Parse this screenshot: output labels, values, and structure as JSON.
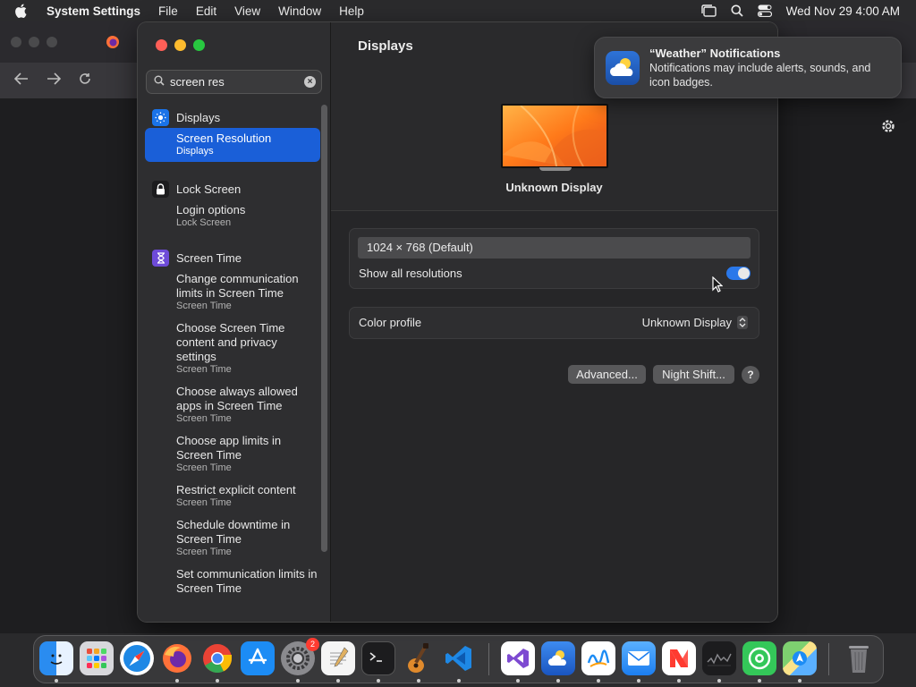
{
  "menubar": {
    "app_name": "System Settings",
    "menus": [
      "File",
      "Edit",
      "View",
      "Window",
      "Help"
    ],
    "datetime": "Wed Nov 29  4:00 AM"
  },
  "sidebar": {
    "search_value": "screen res",
    "categories": [
      {
        "label": "Displays",
        "icon": "sun-icon",
        "color": "#1a73e8",
        "items": [
          {
            "title": "Screen Resolution",
            "subtitle": "Displays",
            "selected": true
          }
        ]
      },
      {
        "label": "Lock Screen",
        "icon": "lock-icon",
        "color": "#1c1c1e",
        "items": [
          {
            "title": "Login options",
            "subtitle": "Lock Screen"
          }
        ]
      },
      {
        "label": "Screen Time",
        "icon": "hourglass-icon",
        "color": "#6e4bd8",
        "items": [
          {
            "title": "Change communication limits in Screen Time",
            "subtitle": "Screen Time"
          },
          {
            "title": "Choose Screen Time content and privacy settings",
            "subtitle": "Screen Time"
          },
          {
            "title": "Choose always allowed apps in Screen Time",
            "subtitle": "Screen Time"
          },
          {
            "title": "Choose app limits in Screen Time",
            "subtitle": "Screen Time"
          },
          {
            "title": "Restrict explicit content",
            "subtitle": "Screen Time"
          },
          {
            "title": "Schedule downtime in Screen Time",
            "subtitle": "Screen Time"
          },
          {
            "title": "Set communication limits in Screen Time",
            "subtitle": ""
          }
        ]
      }
    ]
  },
  "main": {
    "title": "Displays",
    "display_name": "Unknown Display",
    "resolution": "1024 × 768 (Default)",
    "show_all_label": "Show all resolutions",
    "show_all_on": true,
    "color_profile_label": "Color profile",
    "color_profile_value": "Unknown Display",
    "advanced_label": "Advanced...",
    "night_shift_label": "Night Shift...",
    "help_label": "?"
  },
  "notification": {
    "title": "“Weather” Notifications",
    "body": "Notifications may include alerts, sounds, and icon badges."
  },
  "dock": {
    "items": [
      {
        "name": "finder",
        "color": "#2a8cf0"
      },
      {
        "name": "launchpad",
        "color": "#e8e8e8"
      },
      {
        "name": "safari",
        "color": "#1e88e5"
      },
      {
        "name": "firefox",
        "color": "#ff7139"
      },
      {
        "name": "chrome",
        "color": "#ffffff"
      },
      {
        "name": "app-store",
        "color": "#1c8cf5"
      },
      {
        "name": "system-settings",
        "color": "#8a8a8e",
        "badge": "2"
      },
      {
        "name": "textedit",
        "color": "#f5f5f5"
      },
      {
        "name": "terminal",
        "color": "#1c1c1e"
      },
      {
        "name": "garageband",
        "color": "#3a2a20"
      },
      {
        "name": "vscode",
        "color": "#1e1e1e"
      },
      {
        "name": "visual-studio",
        "color": "#ffffff"
      },
      {
        "name": "weather",
        "color": "#2e73d8"
      },
      {
        "name": "freeform",
        "color": "#ffffff"
      },
      {
        "name": "mail",
        "color": "#3c9af5"
      },
      {
        "name": "news",
        "color": "#ffffff"
      },
      {
        "name": "stocks",
        "color": "#1c1c1e"
      },
      {
        "name": "find-my",
        "color": "#34c759"
      },
      {
        "name": "maps",
        "color": "#7ed070"
      },
      {
        "name": "trash",
        "color": "#6a6a6c"
      }
    ]
  }
}
